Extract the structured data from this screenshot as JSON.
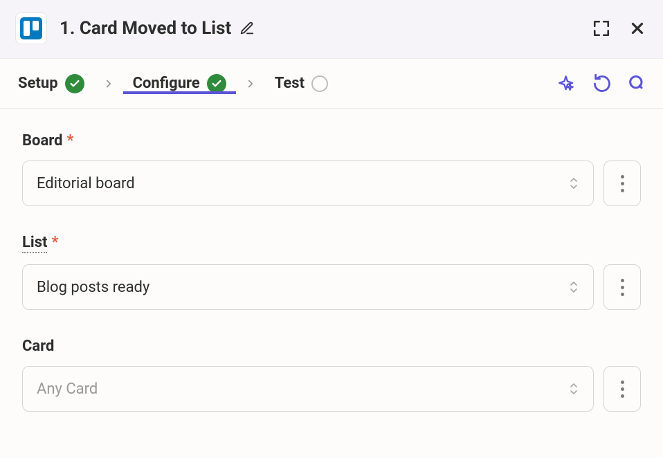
{
  "header": {
    "title": "1. Card Moved to List"
  },
  "steps": {
    "setup": {
      "label": "Setup",
      "status": "done"
    },
    "configure": {
      "label": "Configure",
      "status": "done"
    },
    "test": {
      "label": "Test",
      "status": "pending"
    }
  },
  "form": {
    "board": {
      "label": "Board",
      "required": true,
      "value": "Editorial board"
    },
    "list": {
      "label": "List",
      "required": true,
      "value": "Blog posts ready"
    },
    "card": {
      "label": "Card",
      "required": false,
      "placeholder": "Any Card"
    }
  }
}
